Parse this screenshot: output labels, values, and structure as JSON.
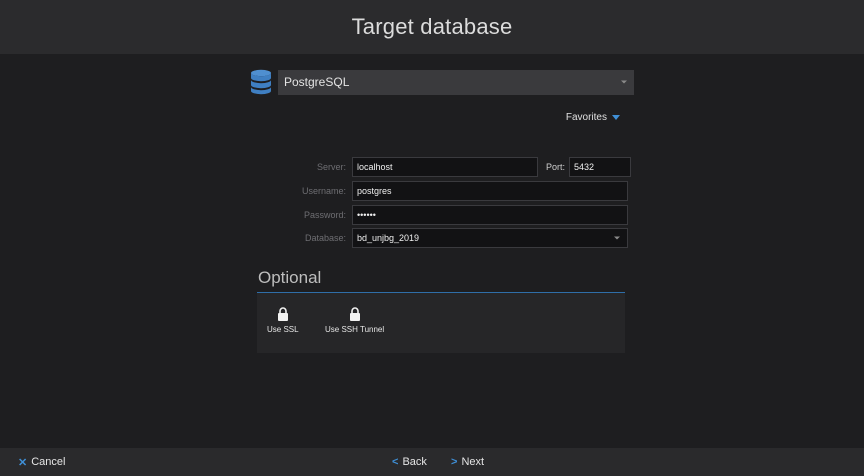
{
  "header": {
    "title": "Target database"
  },
  "database_type": {
    "selected": "PostgreSQL"
  },
  "favorites": {
    "label": "Favorites"
  },
  "form": {
    "server": {
      "label": "Server:",
      "value": "localhost"
    },
    "port": {
      "label": "Port:",
      "value": "5432"
    },
    "username": {
      "label": "Username:",
      "value": "postgres"
    },
    "password": {
      "label": "Password:",
      "value": "••••••"
    },
    "database": {
      "label": "Database:",
      "value": "bd_unjbg_2019"
    }
  },
  "optional": {
    "title": "Optional",
    "items": [
      {
        "label": "Use SSL"
      },
      {
        "label": "Use SSH Tunnel"
      }
    ]
  },
  "footer": {
    "cancel_label": "Cancel",
    "back_label": "Back",
    "next_label": "Next"
  },
  "colors": {
    "accent": "#3f8fd6",
    "background": "#1e1e20",
    "header_bg": "#2b2b2d"
  }
}
